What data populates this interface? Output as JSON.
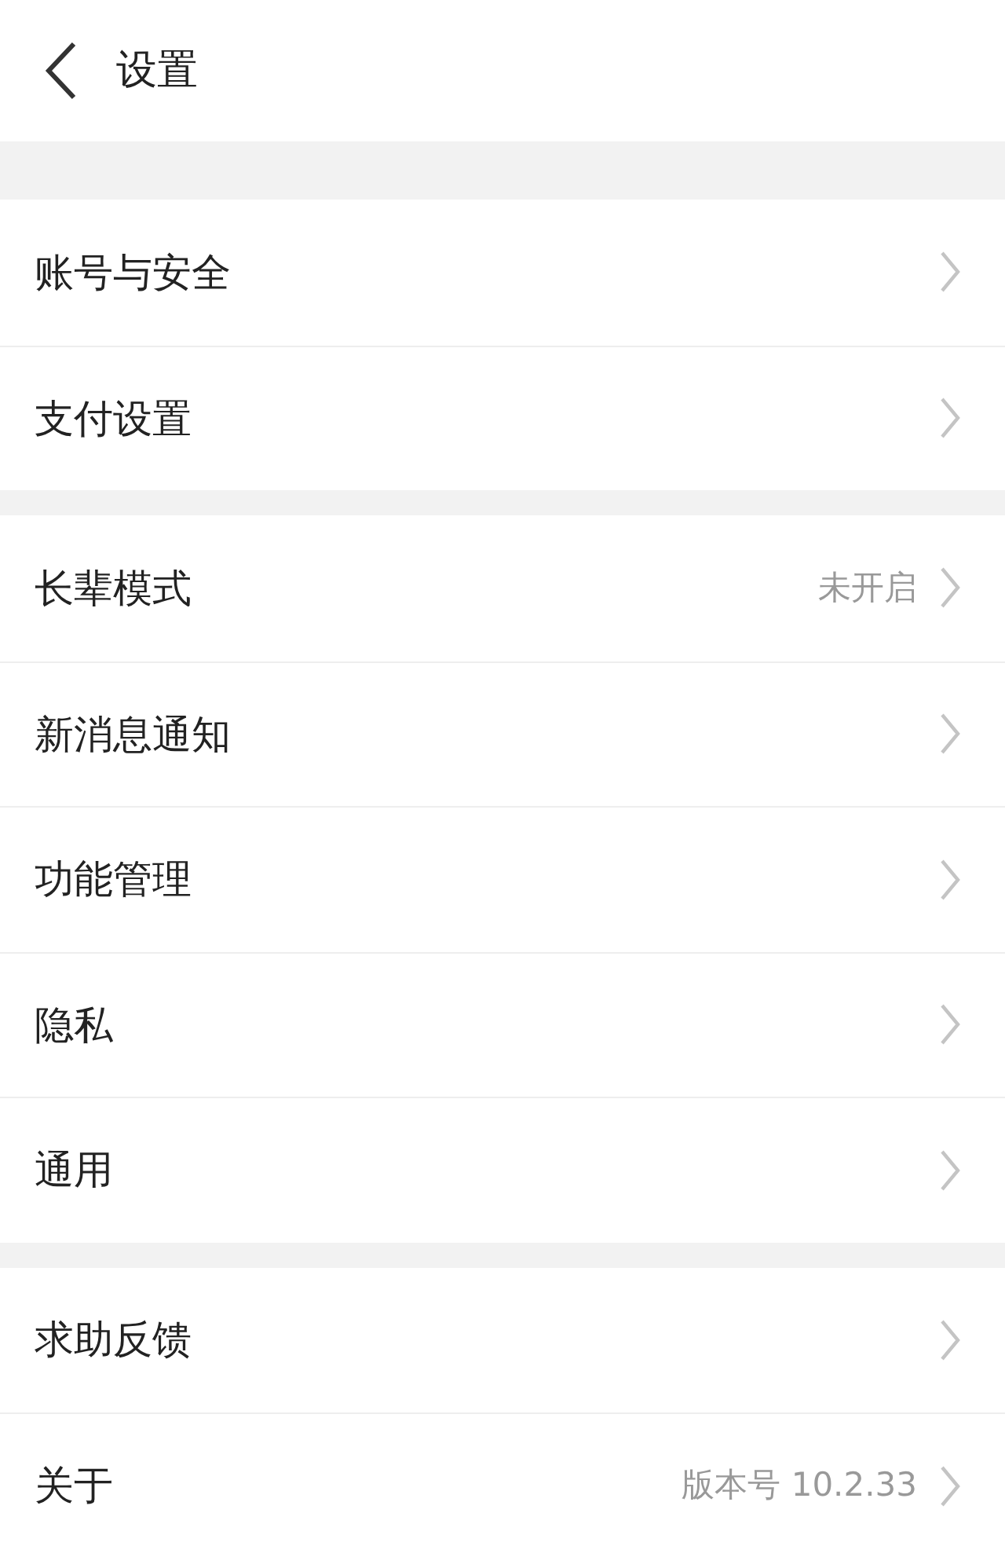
{
  "header": {
    "title": "设置"
  },
  "groups": [
    {
      "items": [
        {
          "label": "账号与安全"
        },
        {
          "label": "支付设置"
        }
      ]
    },
    {
      "items": [
        {
          "label": "长辈模式",
          "value": "未开启"
        },
        {
          "label": "新消息通知"
        },
        {
          "label": "功能管理"
        },
        {
          "label": "隐私"
        },
        {
          "label": "通用"
        }
      ]
    },
    {
      "items": [
        {
          "label": "求助反馈"
        },
        {
          "label": "关于",
          "value": "版本号 10.2.33"
        }
      ]
    }
  ]
}
